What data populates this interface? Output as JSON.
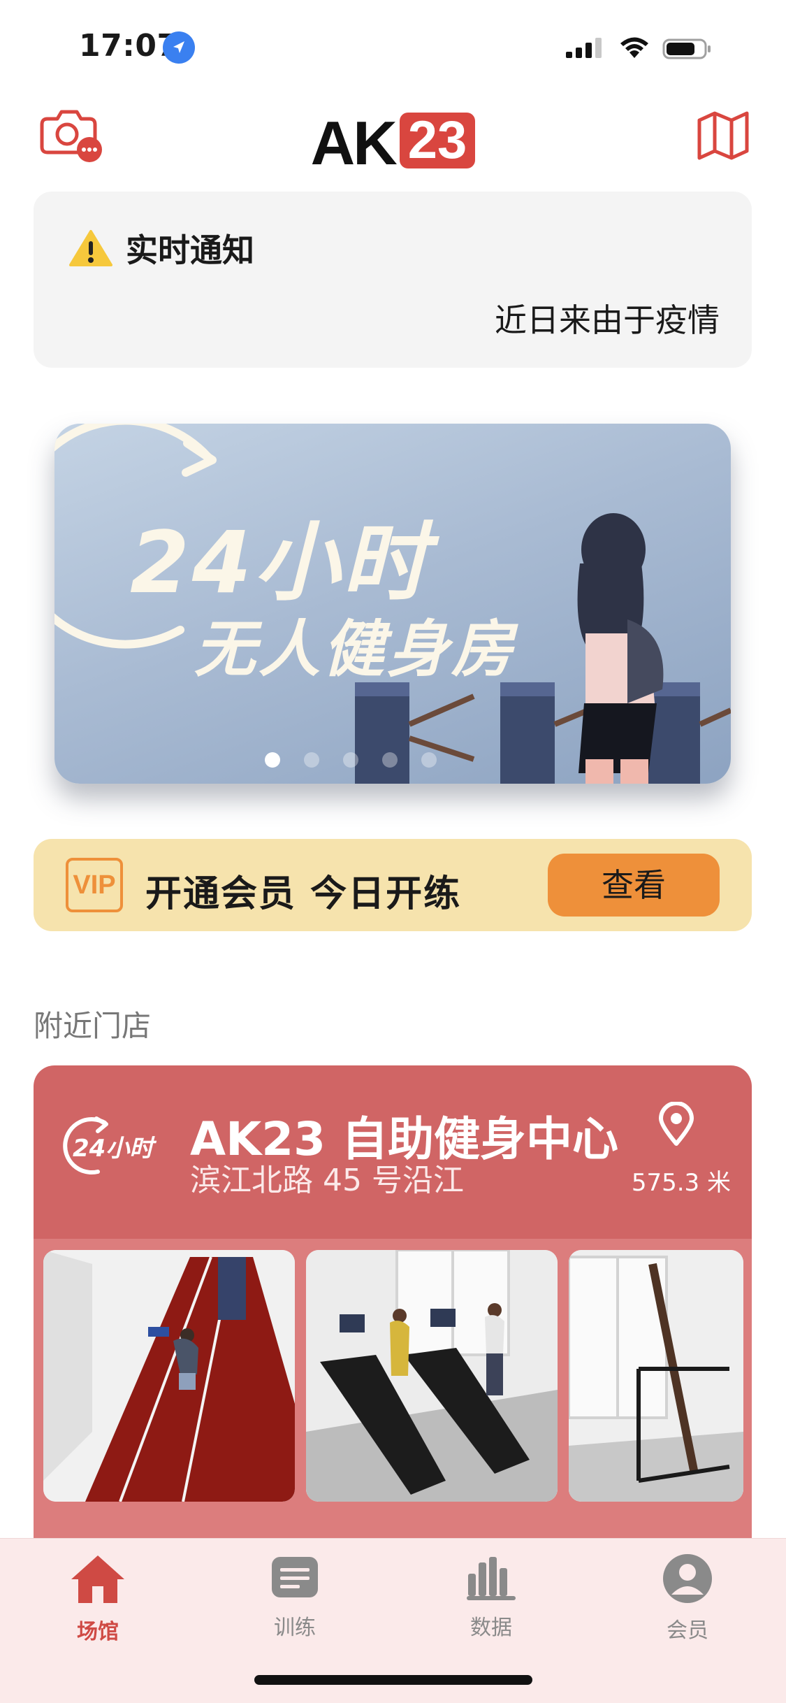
{
  "status": {
    "time": "17:07"
  },
  "header": {
    "brand_letters": "AK",
    "brand_number": "23"
  },
  "notice": {
    "title": "实时通知",
    "text": "近日来由于疫情"
  },
  "banner": {
    "line1": "24小时",
    "line2": "无人健身房",
    "dot_count": 5,
    "active_dot": 0
  },
  "vip": {
    "badge": "VIP",
    "text": "开通会员 今日开练",
    "button": "查看"
  },
  "nearby": {
    "section_title": "附近门店",
    "store": {
      "logo_text": "24小时",
      "name": "AK23 自助健身中心",
      "address": "滨江北路 45 号沿江",
      "distance": "575.3 米"
    }
  },
  "tabbar": {
    "items": [
      {
        "label": "场馆",
        "icon": "home-icon",
        "active": true
      },
      {
        "label": "训练",
        "icon": "document-icon",
        "active": false
      },
      {
        "label": "数据",
        "icon": "bar-chart-icon",
        "active": false
      },
      {
        "label": "会员",
        "icon": "user-icon",
        "active": false
      }
    ]
  },
  "colors": {
    "brand_red": "#d9463f",
    "store_card": "#d06565",
    "vip_bg": "#f6e3ad",
    "vip_accent": "#ee903a",
    "tab_active": "#cf4a44",
    "tab_inactive": "#8a8a8a"
  }
}
